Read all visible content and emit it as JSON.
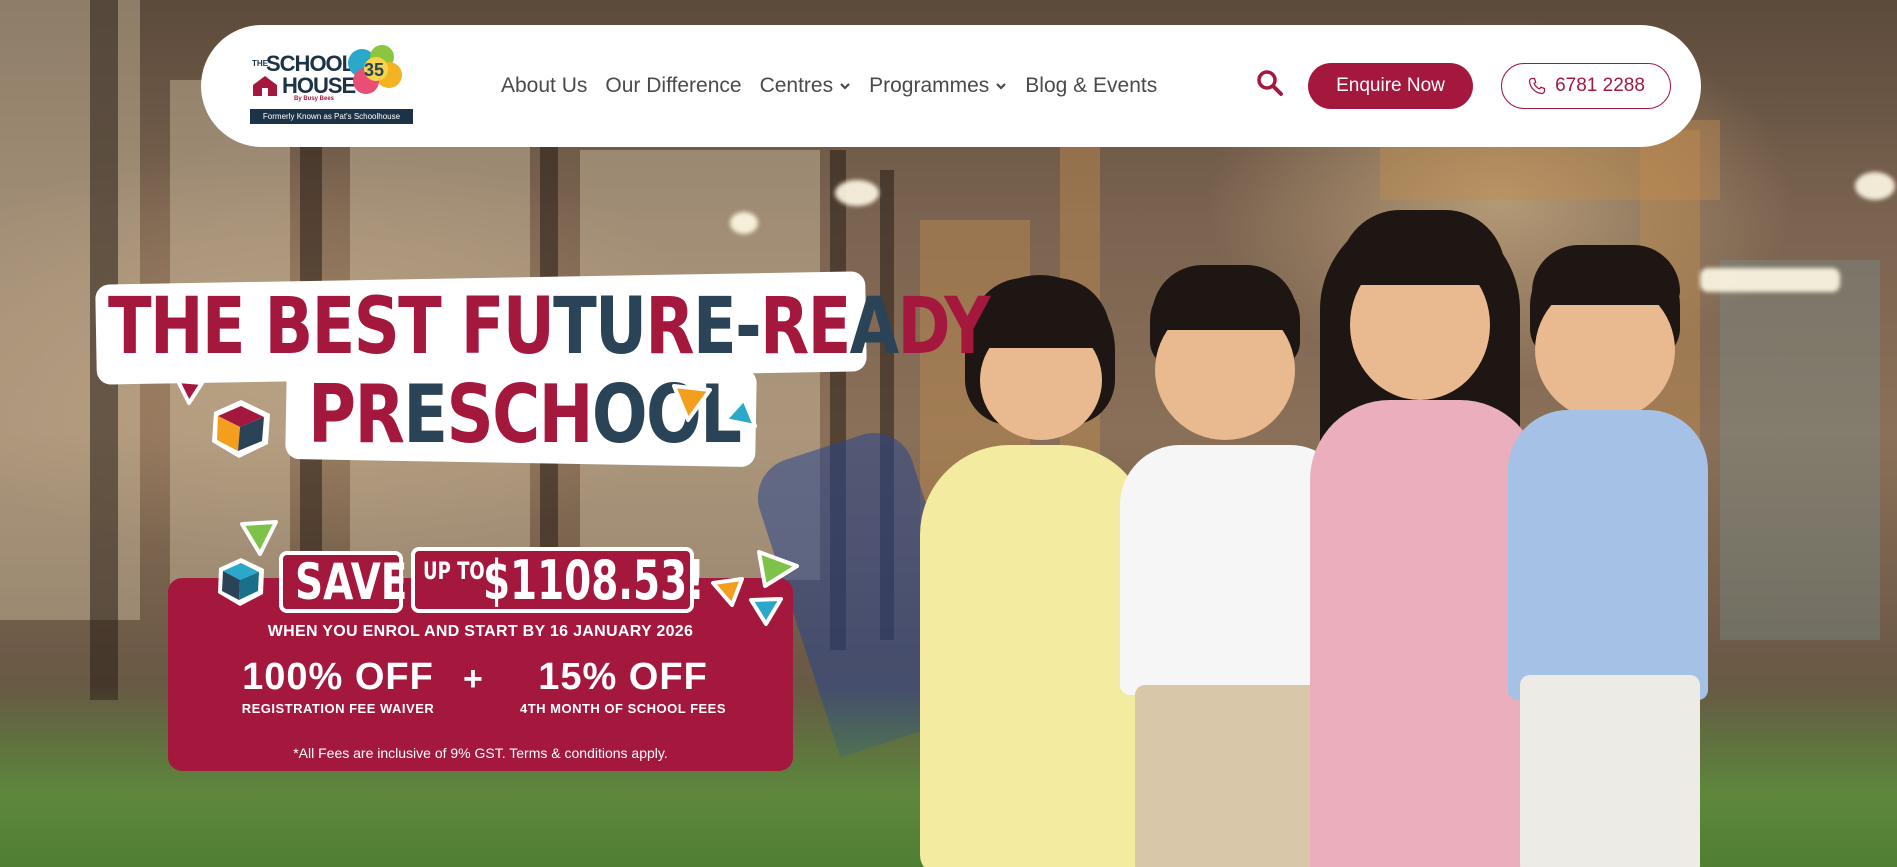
{
  "brand": {
    "logo_the": "THE",
    "logo_school": "SCHOOL",
    "logo_house": "HOUSE",
    "logo_by": "By Busy Bees",
    "logo_anniversary": "35",
    "logo_formerly": "Formerly Known as Pat's Schoolhouse"
  },
  "nav": {
    "items": [
      {
        "label": "About Us",
        "dropdown": false
      },
      {
        "label": "Our Difference",
        "dropdown": false
      },
      {
        "label": "Centres",
        "dropdown": true
      },
      {
        "label": "Programmes",
        "dropdown": true
      },
      {
        "label": "Blog & Events",
        "dropdown": false
      }
    ],
    "enquire_label": "Enquire Now",
    "phone_label": "6781 2288"
  },
  "hero": {
    "headline_part1_red": "THE BEST ",
    "headline_part1_mixed": [
      {
        "text": "FU",
        "color": "red"
      },
      {
        "text": "TU",
        "color": "navy"
      },
      {
        "text": "R",
        "color": "red"
      },
      {
        "text": "E-",
        "color": "navy"
      },
      {
        "text": "RE",
        "color": "red"
      },
      {
        "text": "A",
        "color": "navy"
      },
      {
        "text": "DY",
        "color": "red"
      }
    ],
    "headline_part2": [
      {
        "text": "PR",
        "color": "red"
      },
      {
        "text": "E",
        "color": "navy"
      },
      {
        "text": "SCH",
        "color": "red"
      },
      {
        "text": "OOL",
        "color": "navy"
      }
    ]
  },
  "promo": {
    "save": "SAVE",
    "upto": "UP TO",
    "amount": "$1108.53!",
    "asterisk": "*",
    "subline": "WHEN YOU ENROL AND START BY 16 JANUARY 2026",
    "offer1_big": "100% OFF",
    "offer1_small": "REGISTRATION FEE WAIVER",
    "plus": "+",
    "offer2_big": "15% OFF",
    "offer2_small": "4TH MONTH OF SCHOOL FEES",
    "note": "*All Fees are inclusive of 9% GST. Terms & conditions apply."
  },
  "colors": {
    "brand_red": "#a5183e",
    "brand_navy": "#2b4356",
    "white": "#ffffff"
  },
  "icons": [
    "search-icon",
    "phone-icon",
    "chevron-down-icon",
    "cube-icon",
    "triangle-icon"
  ]
}
